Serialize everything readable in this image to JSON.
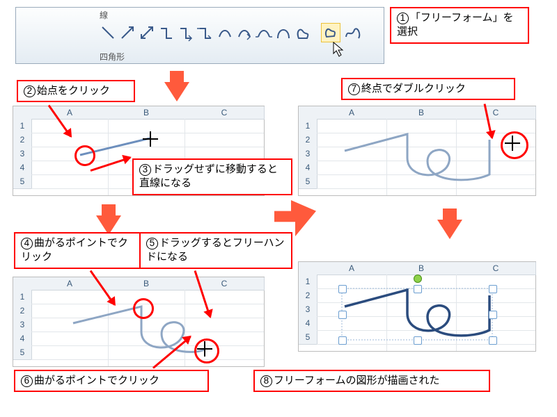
{
  "ribbon": {
    "group_lines": "線",
    "group_rect": "四角形"
  },
  "sheets": {
    "cols": [
      "A",
      "B",
      "C"
    ],
    "rows": [
      "1",
      "2",
      "3",
      "4",
      "5"
    ]
  },
  "callouts": {
    "c1": {
      "n": "1",
      "t": "「フリーフォーム」を選択"
    },
    "c2": {
      "n": "2",
      "t": "始点をクリック"
    },
    "c3": {
      "n": "3",
      "t": "ドラッグせずに移動すると直線になる"
    },
    "c4": {
      "n": "4",
      "t": "曲がるポイントでクリック"
    },
    "c5": {
      "n": "5",
      "t": "ドラッグするとフリーハンドになる"
    },
    "c6": {
      "n": "6",
      "t": "曲がるポイントでクリック"
    },
    "c7": {
      "n": "7",
      "t": "終点でダブルクリック"
    },
    "c8": {
      "n": "8",
      "t": "フリーフォームの図形が描画された"
    }
  },
  "colors": {
    "callout_border": "#ff0000",
    "flow_arrow": "#ff5a3c",
    "shape_stroke": "#2b4c7e",
    "shape_stroke_light": "#8ea6c4"
  }
}
